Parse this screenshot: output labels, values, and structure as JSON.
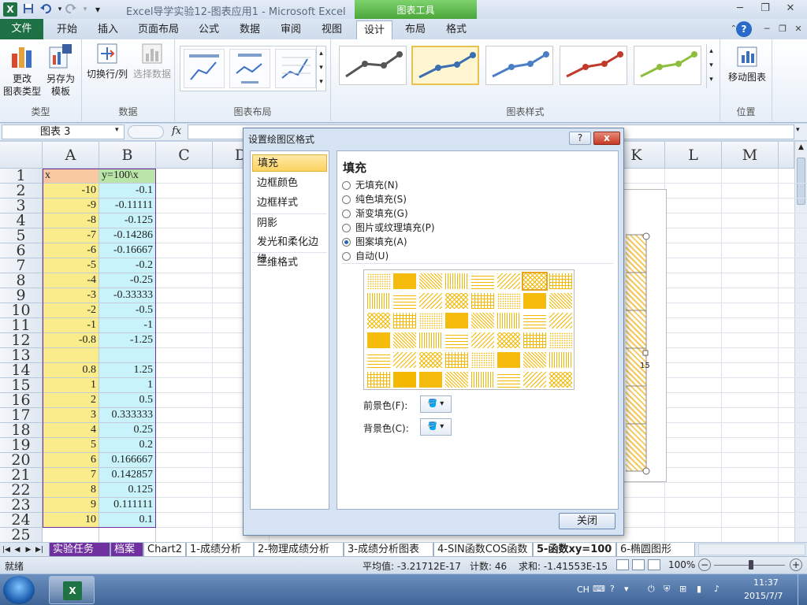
{
  "window": {
    "title": "Excel导学实验12-图表应用1  -  Microsoft Excel",
    "context_tab_title": "图表工具",
    "app_icon": "X"
  },
  "quick_access": {
    "save_icon": "save-icon",
    "undo_icon": "undo-icon",
    "redo_icon": "redo-icon"
  },
  "tabs": [
    {
      "label": "文件"
    },
    {
      "label": "开始"
    },
    {
      "label": "插入"
    },
    {
      "label": "页面布局"
    },
    {
      "label": "公式"
    },
    {
      "label": "数据"
    },
    {
      "label": "审阅"
    },
    {
      "label": "视图"
    },
    {
      "label": "设计"
    },
    {
      "label": "布局"
    },
    {
      "label": "格式"
    }
  ],
  "ribbon": {
    "groups": {
      "type": "类型",
      "data": "数据",
      "layout": "图表布局",
      "styles": "图表样式",
      "location": "位置"
    },
    "buttons": {
      "change_type_1": "更改",
      "change_type_2": "图表类型",
      "save_template_1": "另存为",
      "save_template_2": "模板",
      "switch_row_col": "切换行/列",
      "select_data": "选择数据",
      "move_chart": "移动图表"
    }
  },
  "formula_bar": {
    "name_box": "图表 3",
    "fx": "fx",
    "formula": ""
  },
  "columns": [
    "A",
    "B",
    "C",
    "D",
    "K",
    "L",
    "M"
  ],
  "rows": [
    {
      "n": "1",
      "a": "x",
      "b": "y=100\\x"
    },
    {
      "n": "2",
      "a": "-10",
      "b": "-0.1"
    },
    {
      "n": "3",
      "a": "-9",
      "b": "-0.11111"
    },
    {
      "n": "4",
      "a": "-8",
      "b": "-0.125"
    },
    {
      "n": "5",
      "a": "-7",
      "b": "-0.14286"
    },
    {
      "n": "6",
      "a": "-6",
      "b": "-0.16667"
    },
    {
      "n": "7",
      "a": "-5",
      "b": "-0.2"
    },
    {
      "n": "8",
      "a": "-4",
      "b": "-0.25"
    },
    {
      "n": "9",
      "a": "-3",
      "b": "-0.33333"
    },
    {
      "n": "10",
      "a": "-2",
      "b": "-0.5"
    },
    {
      "n": "11",
      "a": "-1",
      "b": "-1"
    },
    {
      "n": "12",
      "a": "-0.8",
      "b": "-1.25"
    },
    {
      "n": "13",
      "a": "",
      "b": ""
    },
    {
      "n": "14",
      "a": "0.8",
      "b": "1.25"
    },
    {
      "n": "15",
      "a": "1",
      "b": "1"
    },
    {
      "n": "16",
      "a": "2",
      "b": "0.5"
    },
    {
      "n": "17",
      "a": "3",
      "b": "0.333333"
    },
    {
      "n": "18",
      "a": "4",
      "b": "0.25"
    },
    {
      "n": "19",
      "a": "5",
      "b": "0.2"
    },
    {
      "n": "20",
      "a": "6",
      "b": "0.166667"
    },
    {
      "n": "21",
      "a": "7",
      "b": "0.142857"
    },
    {
      "n": "22",
      "a": "8",
      "b": "0.125"
    },
    {
      "n": "23",
      "a": "9",
      "b": "0.111111"
    },
    {
      "n": "24",
      "a": "10",
      "b": "0.1"
    },
    {
      "n": "25",
      "a": "",
      "b": ""
    }
  ],
  "chart_fragment": {
    "axis_label": "15"
  },
  "dialog": {
    "title": "设置绘图区格式",
    "help": "?",
    "close_x": "x",
    "nav": [
      "填充",
      "边框颜色",
      "边框样式",
      "阴影",
      "发光和柔化边缘",
      "三维格式"
    ],
    "section_title": "填充",
    "options": [
      {
        "label": "无填充(N)",
        "selected": false
      },
      {
        "label": "纯色填充(S)",
        "selected": false
      },
      {
        "label": "渐变填充(G)",
        "selected": false
      },
      {
        "label": "图片或纹理填充(P)",
        "selected": false
      },
      {
        "label": "图案填充(A)",
        "selected": true
      },
      {
        "label": "自动(U)",
        "selected": false
      }
    ],
    "foreground_label": "前景色(F):",
    "background_label": "背景色(C):",
    "pattern_color": "#f5b800",
    "close_button": "关闭"
  },
  "sheet_tabs": [
    {
      "label": "实验任务"
    },
    {
      "label": "档案"
    },
    {
      "label": "Chart2"
    },
    {
      "label": "1-成绩分析"
    },
    {
      "label": "2-物理成绩分析"
    },
    {
      "label": "3-成绩分析图表"
    },
    {
      "label": "4-SIN函数COS函数"
    },
    {
      "label": "5-函数xy=100"
    },
    {
      "label": "6-椭圆图形"
    }
  ],
  "status": {
    "ready": "就绪",
    "average": "平均值: -3.21712E-17",
    "count": "计数: 46",
    "sum": "求和: -1.41553E-15",
    "zoom": "100%"
  },
  "taskbar": {
    "lang": "CH",
    "time": "11:37",
    "date": "2015/7/7"
  }
}
